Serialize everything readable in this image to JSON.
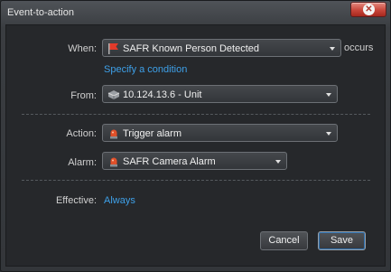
{
  "window": {
    "title": "Event-to-action"
  },
  "when": {
    "label": "When:",
    "value": "SAFR Known Person Detected",
    "icon": "red-flag-icon",
    "suffix": "occurs",
    "condition_link": "Specify a condition"
  },
  "from": {
    "label": "From:",
    "value": "10.124.13.6 - Unit",
    "icon": "unit-device-icon"
  },
  "action": {
    "label": "Action:",
    "value": "Trigger alarm",
    "icon": "alarm-light-icon"
  },
  "alarm": {
    "label": "Alarm:",
    "value": "SAFR Camera Alarm",
    "icon": "alarm-light-icon"
  },
  "effective": {
    "label": "Effective:",
    "value": "Always"
  },
  "buttons": {
    "cancel": "Cancel",
    "save": "Save"
  },
  "colors": {
    "link": "#3ea0e8",
    "close": "#c8463a",
    "alarm": "#e0502a"
  }
}
